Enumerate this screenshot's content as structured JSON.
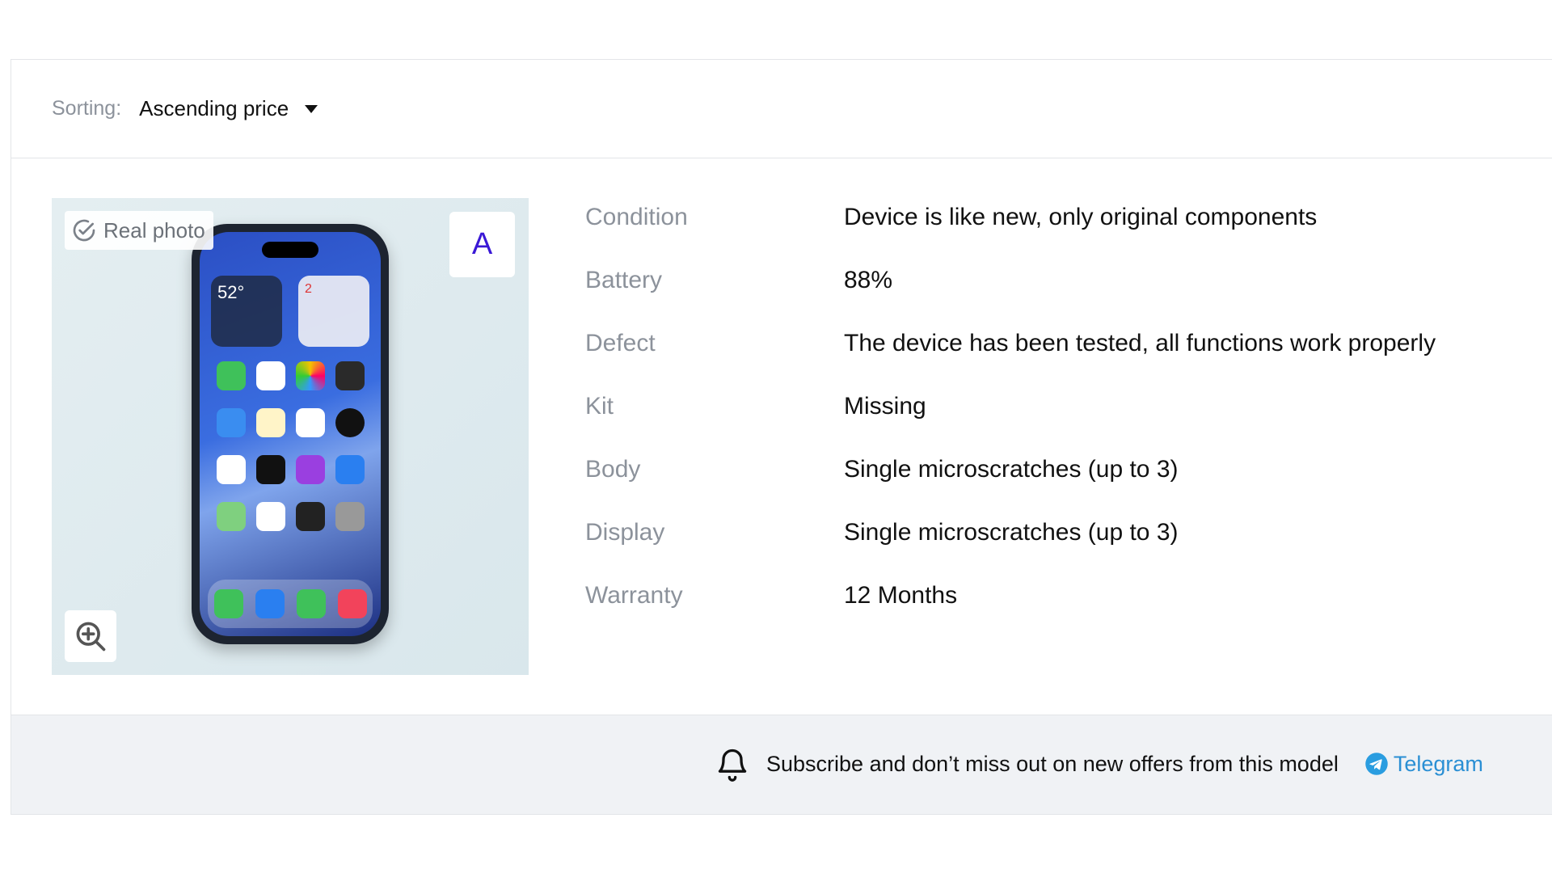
{
  "sorting": {
    "label": "Sorting:",
    "selected": "Ascending price"
  },
  "product": {
    "photo_badge": "Real photo",
    "grade": "A",
    "phone_widget_temp": "52°",
    "phone_widget_date": "2"
  },
  "specs": [
    {
      "label": "Condition",
      "value": "Device is like new, only original components"
    },
    {
      "label": "Battery",
      "value": "88%"
    },
    {
      "label": "Defect",
      "value": "The device has been tested, all functions work properly"
    },
    {
      "label": "Kit",
      "value": "Missing"
    },
    {
      "label": "Body",
      "value": "Single microscratches (up to 3)"
    },
    {
      "label": "Display",
      "value": "Single microscratches (up to 3)"
    },
    {
      "label": "Warranty",
      "value": "12 Months"
    }
  ],
  "subscribe": {
    "text": "Subscribe and don’t miss out on new offers from this model",
    "telegram_label": "Telegram"
  },
  "colors": {
    "grade_accent": "#3a18d6",
    "telegram": "#2a8fd4",
    "label_gray": "#8c929b"
  },
  "icons": {
    "photo_badge": "check-circle-icon",
    "zoom": "zoom-in-icon",
    "subscribe": "bell-icon",
    "telegram": "telegram-icon",
    "sort": "caret-down-icon"
  }
}
